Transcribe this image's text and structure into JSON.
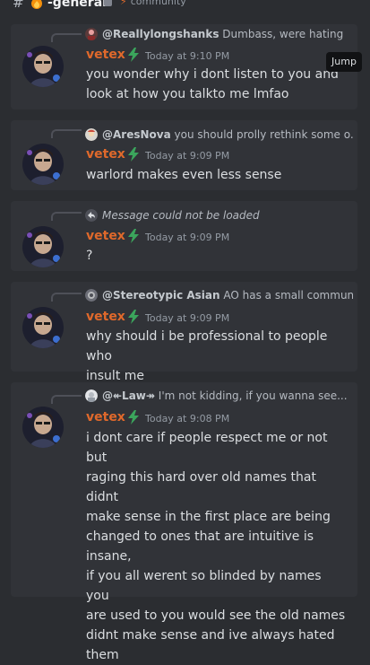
{
  "channel": {
    "hash": "#",
    "name": "-general",
    "topic": "community",
    "fire_icon": "fire-emoji",
    "accent": "#e0692b"
  },
  "jump_label": "Jump",
  "messages": [
    {
      "reply_author": "@Reallylongshanks",
      "reply_preview": "Dumbass, were hating",
      "author": "vetex",
      "time": "Today at 9:10 PM",
      "lines": [
        "you wonder why i dont listen to you and",
        "look at how you talkto me lmfao"
      ]
    },
    {
      "reply_author": "@AresNova",
      "reply_preview": "you should prolly rethink some o...",
      "author": "vetex",
      "time": "Today at 9:09 PM",
      "lines": [
        "warlord makes even less sense"
      ]
    },
    {
      "reply_error": "Message could not be loaded",
      "author": "vetex",
      "time": "Today at 9:09 PM",
      "lines": [
        "?"
      ]
    },
    {
      "reply_author": "@Stereotypic Asian",
      "reply_preview": "AO has a small commun...",
      "author": "vetex",
      "time": "Today at 9:09 PM",
      "lines": [
        "why should i be professional to people who",
        "insult me"
      ]
    },
    {
      "reply_author": "@↞Law↠",
      "reply_preview": "I'm not kidding, if you wanna see...",
      "author": "vetex",
      "time": "Today at 9:08 PM",
      "lines": [
        "i dont care if people respect me or not but",
        "raging this hard over old names that didnt",
        "make sense in the first place are being",
        "changed to ones that are intuitive is insane,",
        "if you all werent so blinded by names you",
        "are used to you would see the old names",
        "didnt make sense and ive always hated",
        "them"
      ]
    }
  ]
}
